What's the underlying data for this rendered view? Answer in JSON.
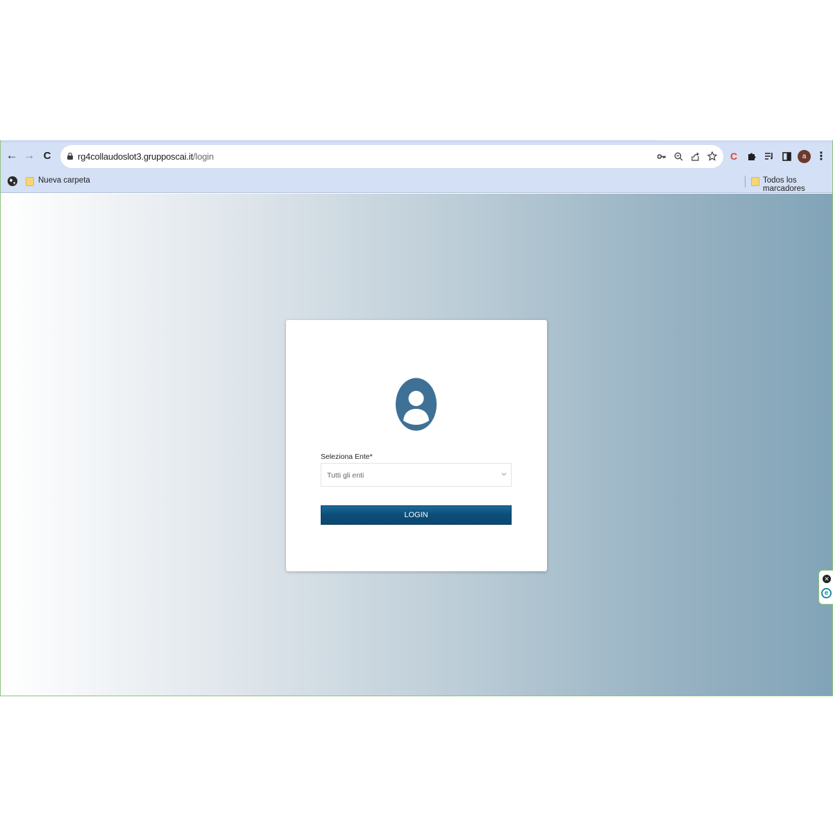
{
  "browser": {
    "url_host": "rg4collaudoslot3.grupposcai.it",
    "url_path": "/login",
    "nav": {
      "back": "←",
      "forward": "→",
      "reload": "C"
    },
    "omnibox_icons": {
      "key": "key-icon",
      "zoom": "zoom-icon",
      "share": "share-icon",
      "star": "star-icon"
    },
    "extensions": {
      "ext1": "C",
      "puzzle": "puzzle-icon",
      "reading_list": "reading-list-icon",
      "side_panel": "side-panel-icon",
      "menu": "⋮"
    },
    "avatar_letter": "a"
  },
  "bookmarks": {
    "folder_label": "Nueva carpeta",
    "all_bookmarks_label": "Todos los marcadores"
  },
  "login": {
    "select_label": "Seleziona Ente*",
    "select_value": "Tutti gli enti",
    "button_label": "LOGIN",
    "accent_color": "#0c4f7a",
    "icon_color": "#3f7196"
  }
}
